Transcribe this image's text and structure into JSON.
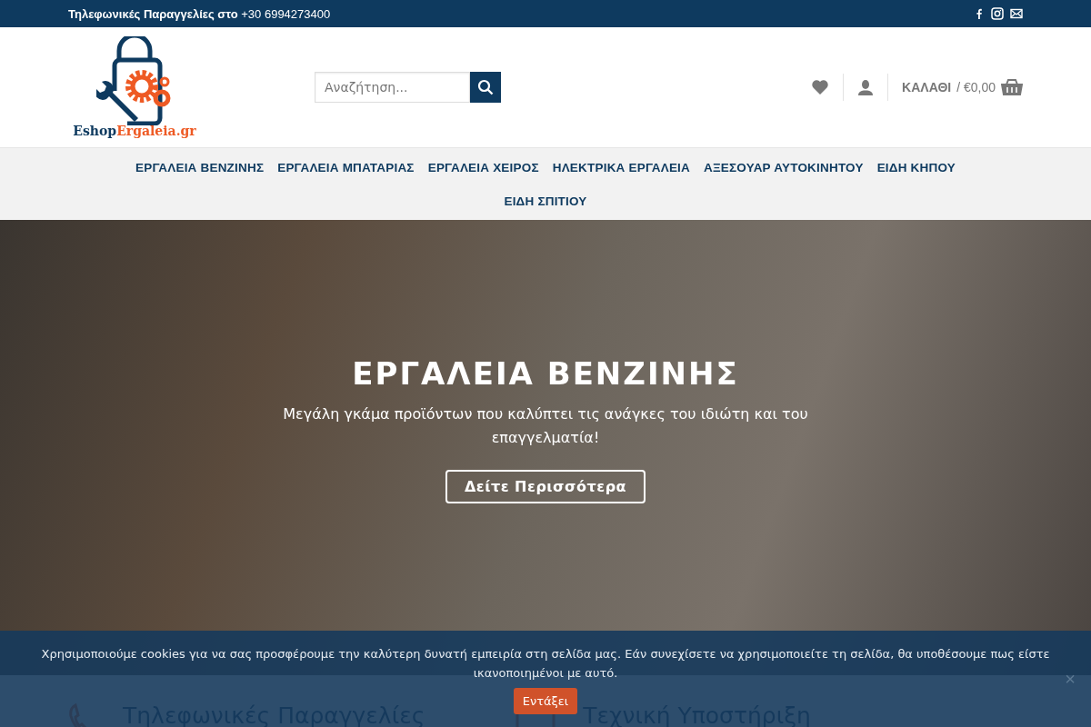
{
  "top_bar": {
    "phone_label": "Τηλεφωνικές Παραγγελίες στο",
    "phone_number": "+30 6994273400"
  },
  "header": {
    "logo": {
      "part_1": "Eshop",
      "part_2": "Ergaleia.gr"
    },
    "search": {
      "placeholder": "Αναζήτηση..."
    },
    "cart": {
      "label": "ΚΑΛΑΘΙ",
      "amount": "/ €0,00"
    }
  },
  "nav": {
    "items": [
      {
        "label": "ΕΡΓΑΛΕΙΑ ΒΕΝΖΙΝΗΣ"
      },
      {
        "label": "ΕΡΓΑΛΕΙΑ ΜΠΑΤΑΡΙΑΣ"
      },
      {
        "label": "ΕΡΓΑΛΕΙΑ ΧΕΙΡΟΣ"
      },
      {
        "label": "ΗΛΕΚΤΡΙΚΑ ΕΡΓΑΛΕΙΑ"
      },
      {
        "label": "ΑΞΕΣΟΥΑΡ ΑΥΤΟΚΙΝΗΤΟΥ"
      },
      {
        "label": "ΕΙΔΗ ΚΗΠΟΥ"
      },
      {
        "label": "ΕΙΔΗ ΣΠΙΤΙΟΥ"
      }
    ]
  },
  "hero": {
    "title": "ΕΡΓΑΛΕΙΑ ΒΕΝΖΙΝΗΣ",
    "text": "Μεγάλη γκάμα προϊόντων που καλύπτει τις ανάγκες του ιδιώτη και του επαγγελματία!",
    "button": "Δείτε Περισσότερα"
  },
  "features": [
    {
      "kind": "phone",
      "title": "Τηλεφωνικές Παραγγελίες"
    },
    {
      "kind": "support",
      "title": "Τεχνική Υποστήριξη"
    }
  ],
  "cookie_banner": {
    "text": "Χρησιμοποιούμε cookies για να σας προσφέρουμε την καλύτερη δυνατή εμπειρία στη σελίδα μας. Εάν συνεχίσετε να χρησιμοποιείτε τη σελίδα, θα υποθέσουμε πως είστε ικανοποιημένοι με αυτό.",
    "button": "Εντάξει",
    "close": "×"
  }
}
